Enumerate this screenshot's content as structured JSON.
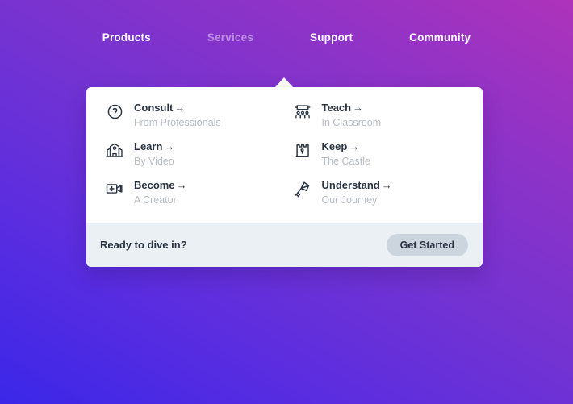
{
  "nav": {
    "items": [
      {
        "label": "Products",
        "active": false
      },
      {
        "label": "Services",
        "active": true
      },
      {
        "label": "Support",
        "active": false
      },
      {
        "label": "Community",
        "active": false
      }
    ]
  },
  "dropdown": {
    "arrow_glyph": "→",
    "items": [
      {
        "icon": "question-circle-icon",
        "title": "Consult",
        "subtitle": "From Professionals"
      },
      {
        "icon": "classroom-icon",
        "title": "Teach",
        "subtitle": "In Classroom"
      },
      {
        "icon": "school-building-icon",
        "title": "Learn",
        "subtitle": "By Video"
      },
      {
        "icon": "castle-keep-icon",
        "title": "Keep",
        "subtitle": "The Castle"
      },
      {
        "icon": "video-plus-icon",
        "title": "Become",
        "subtitle": "A Creator"
      },
      {
        "icon": "kite-icon",
        "title": "Understand",
        "subtitle": "Our Journey"
      }
    ],
    "footer": {
      "text": "Ready to dive in?",
      "button_label": "Get Started"
    }
  },
  "colors": {
    "gradient_start": "#3b27e8",
    "gradient_end": "#ae33ba",
    "card_bg": "#ffffff",
    "footer_bg": "#eaf0f3",
    "text_dark": "#2a3442",
    "text_muted": "#b6bcc4",
    "button_bg": "#ccd5dd"
  }
}
